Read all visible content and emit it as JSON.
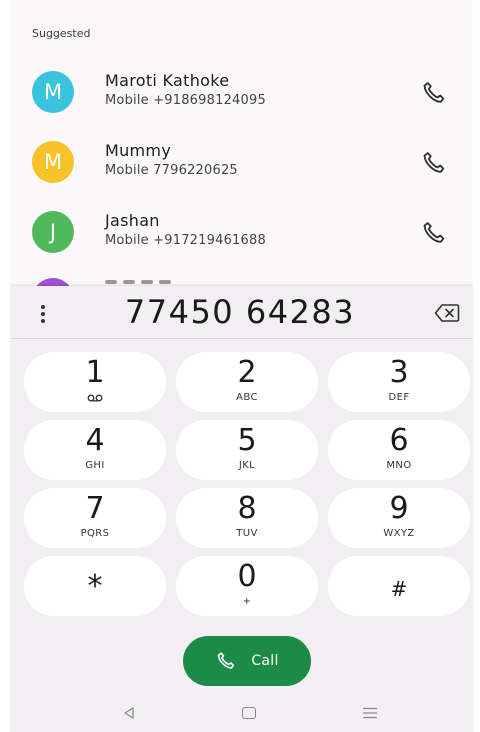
{
  "suggested": {
    "label": "Suggested",
    "contacts": [
      {
        "initial": "M",
        "name": "Maroti Kathoke",
        "number": "Mobile +918698124095",
        "color": "#39c3dd"
      },
      {
        "initial": "M",
        "name": "Mummy",
        "number": "Mobile 7796220625",
        "color": "#f7c328"
      },
      {
        "initial": "J",
        "name": "Jashan",
        "number": "Mobile +917219461688",
        "color": "#50b95a"
      }
    ],
    "peek_color": "#a04fd6"
  },
  "dialer": {
    "number": "77450 64283",
    "keys": [
      {
        "digit": "1",
        "letters": "",
        "icon": "voicemail-icon"
      },
      {
        "digit": "2",
        "letters": "ABC"
      },
      {
        "digit": "3",
        "letters": "DEF"
      },
      {
        "digit": "4",
        "letters": "GHI"
      },
      {
        "digit": "5",
        "letters": "JKL"
      },
      {
        "digit": "6",
        "letters": "MNO"
      },
      {
        "digit": "7",
        "letters": "PQRS"
      },
      {
        "digit": "8",
        "letters": "TUV"
      },
      {
        "digit": "9",
        "letters": "WXYZ"
      },
      {
        "digit": "*",
        "letters": ""
      },
      {
        "digit": "0",
        "letters": "+"
      },
      {
        "digit": "#",
        "letters": ""
      }
    ],
    "call_label": "Call",
    "call_color": "#1c8b48"
  },
  "icons": {
    "menu": "more-vert-icon",
    "backspace": "backspace-icon",
    "call": "phone-icon",
    "nav_back": "triangle-back-icon",
    "nav_home": "square-home-icon",
    "nav_recent": "menu-lines-icon"
  }
}
